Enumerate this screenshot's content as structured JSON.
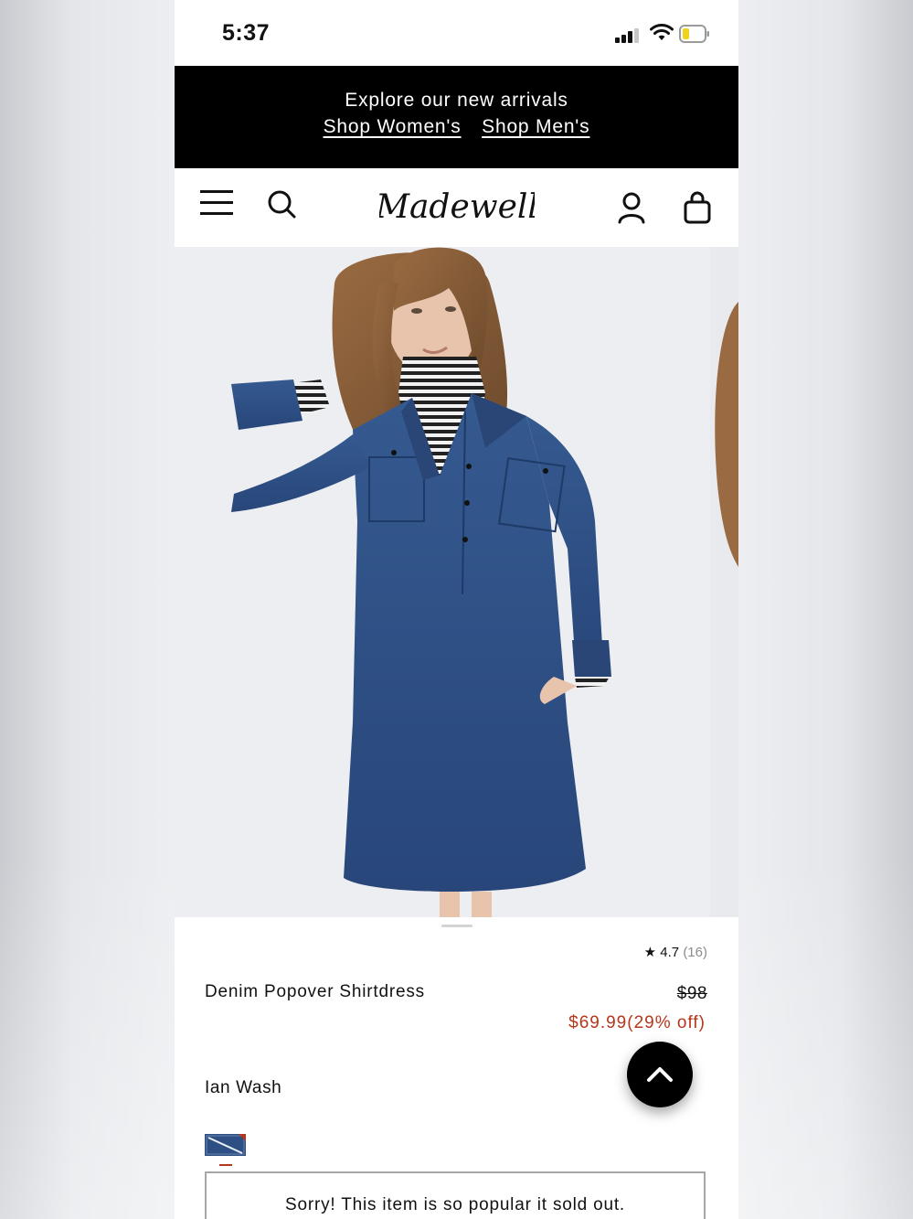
{
  "status_bar": {
    "time": "5:37"
  },
  "promo": {
    "title": "Explore our new arrivals",
    "link_women": "Shop Women's",
    "link_men": "Shop Men's"
  },
  "header": {
    "brand": "Madewell",
    "icons": [
      "menu-icon",
      "search-icon",
      "account-icon",
      "bag-icon"
    ]
  },
  "product": {
    "rating": "4.7",
    "review_count": "(16)",
    "name": "Denim Popover Shirtdress",
    "original_price": "$98",
    "sale_price": "$69.99(29% off)",
    "color_name": "Ian Wash",
    "soldout_message": "Sorry! This item is so popular it sold out."
  },
  "colors": {
    "promo_bg": "#000000",
    "sale_price": "#b5361b",
    "denim": "#2e4f84"
  }
}
